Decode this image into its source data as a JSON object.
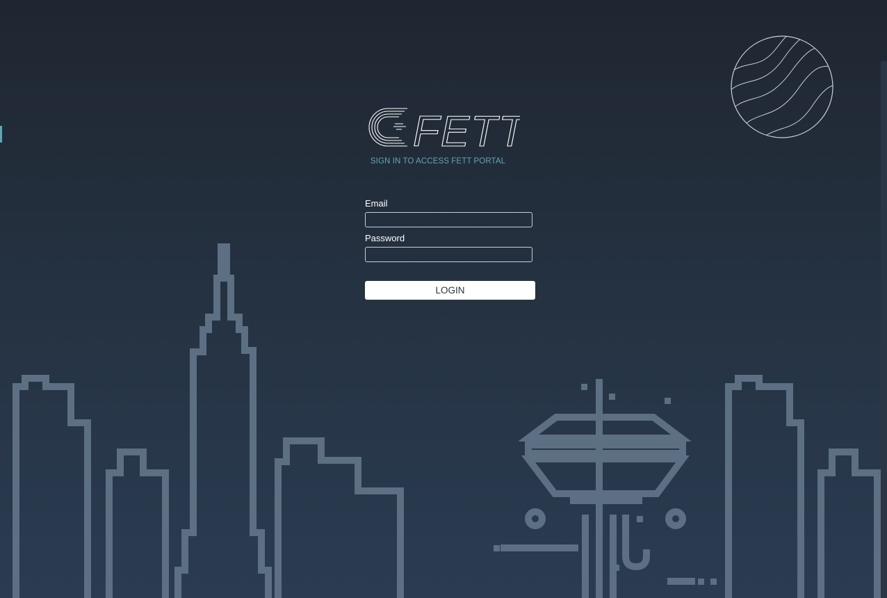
{
  "brand": {
    "logo_text": "FETT",
    "subtitle": "SIGN IN TO ACCESS FETT PORTAL"
  },
  "login_form": {
    "email_label": "Email",
    "email_value": "",
    "password_label": "Password",
    "password_value": "",
    "submit_label": "LOGIN"
  },
  "colors": {
    "background_top": "#1f2630",
    "background_bottom": "#2b3c52",
    "accent_teal": "#5ea7b2",
    "skyline_stroke": "#5c6f83",
    "button_bg": "#ffffff"
  },
  "decorations": {
    "skyline": "city-skyline-outline",
    "planet": "striped-planet-outline",
    "tower": "space-needle-outline"
  }
}
